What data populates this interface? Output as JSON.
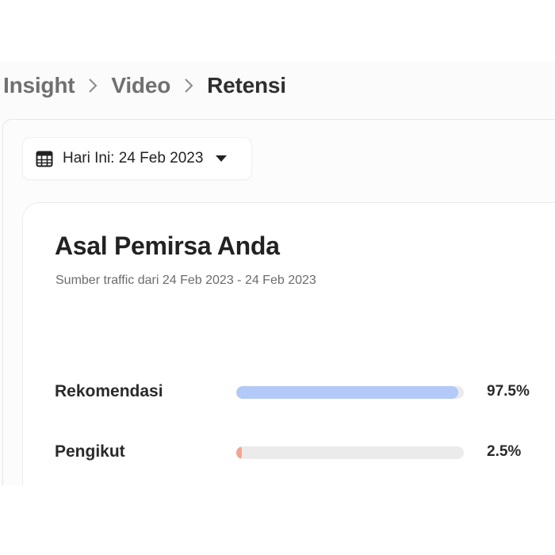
{
  "breadcrumb": {
    "items": [
      "Insight",
      "Video",
      "Retensi"
    ]
  },
  "date_filter": {
    "label": "Hari Ini: 24 Feb 2023",
    "icon": "calendar-icon"
  },
  "card": {
    "title": "Asal Pemirsa Anda",
    "subtitle": "Sumber traffic dari 24 Feb 2023 - 24 Feb 2023"
  },
  "traffic_sources": [
    {
      "label": "Rekomendasi",
      "percent_text": "97.5%",
      "percent": 97.5,
      "color": "#b3c9f7"
    },
    {
      "label": "Pengikut",
      "percent_text": "2.5%",
      "percent": 2.5,
      "color": "#f2a593"
    }
  ]
}
